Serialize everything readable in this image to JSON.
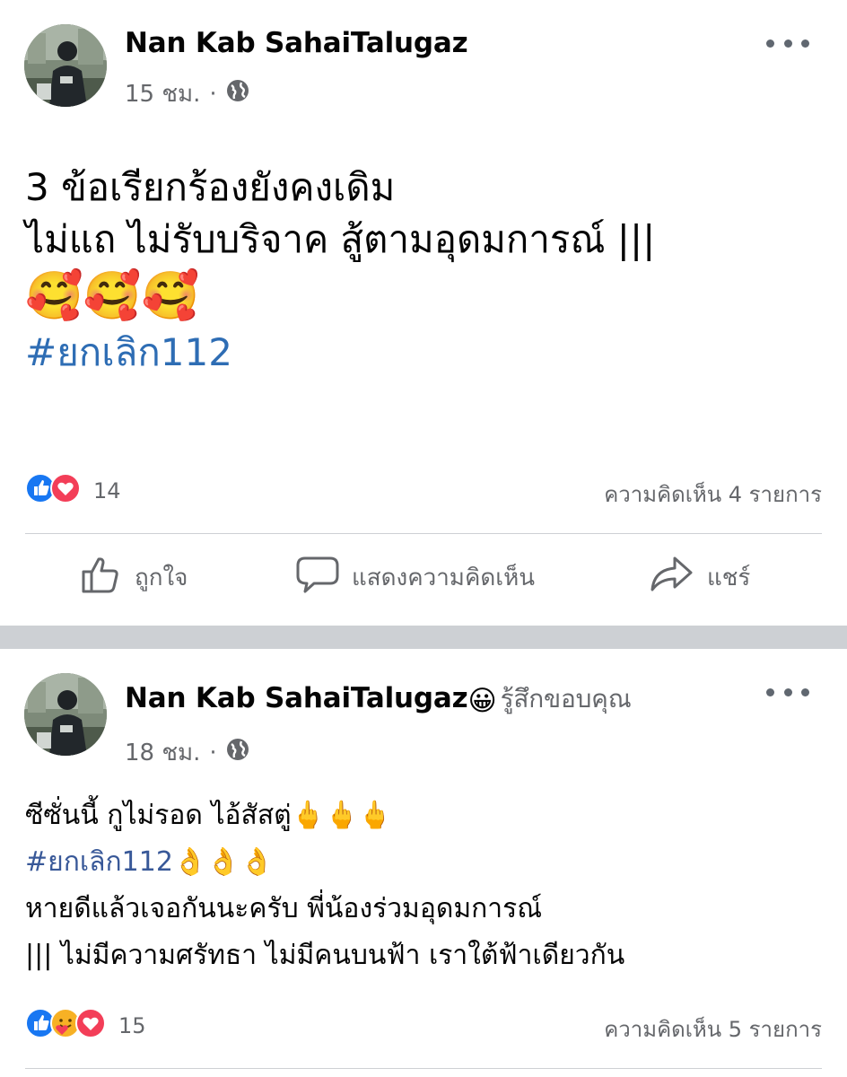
{
  "posts": [
    {
      "author": "Nan Kab SahaiTalugaz",
      "time": "15 ชม.",
      "separator_dot": "·",
      "audience_icon": "globe-icon",
      "text_lines": [
        "3 ข้อเรียกร้องยังคงเดิม",
        "ไม่แถ ไม่รับบริจาค สู้ตามอุดมการณ์ |||"
      ],
      "emojis": "🥰🥰🥰",
      "hashtag": "#ยกเลิก112",
      "reaction_icons": [
        "like-reaction-icon",
        "love-reaction-icon"
      ],
      "reaction_count": "14",
      "comments_label": "ความคิดเห็น 4 รายการ",
      "actions": {
        "like": "ถูกใจ",
        "comment": "แสดงความคิดเห็น",
        "share": "แชร์"
      }
    },
    {
      "author": "Nan Kab SahaiTalugaz",
      "feeling_emoji": "😀",
      "feeling_text": "รู้สึกขอบคุณ",
      "time": "18 ชม.",
      "separator_dot": "·",
      "audience_icon": "globe-icon",
      "line1_text": "ซีซั่นนี้ กูไม่รอด ไอ้สัสตู่",
      "line1_emojis": "🖕🖕🖕",
      "hashtag": "#ยกเลิก112",
      "line2_emojis": "👌👌👌",
      "line3": "หายดีแล้วเจอกันนะครับ พี่น้องร่วมอุดมการณ์",
      "line4": "||| ไม่มีความศรัทธา ไม่มีคนบนฟ้า เราใต้ฟ้าเดียวกัน",
      "reaction_icons": [
        "like-reaction-icon",
        "care-reaction-icon",
        "love-reaction-icon"
      ],
      "reaction_count": "15",
      "comments_label": "ความคิดเห็น 5 รายการ"
    }
  ],
  "colors": {
    "hashtag": "#385898",
    "like_blue": "#1877f2",
    "love_red": "#f33e58",
    "separator": "#cdd0d4"
  }
}
